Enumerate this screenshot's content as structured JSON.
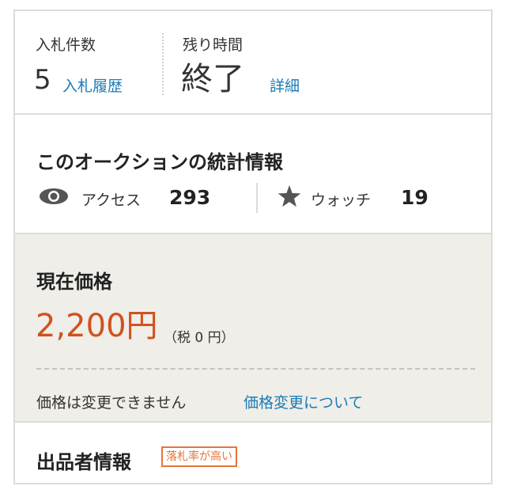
{
  "bids": {
    "count_label": "入札件数",
    "count_value": "5",
    "history_link": "入札履歴",
    "time_label": "残り時間",
    "time_value": "終了",
    "detail_link": "詳細"
  },
  "stats": {
    "title": "このオークションの統計情報",
    "access_label": "アクセス",
    "access_value": "293",
    "watch_label": "ウォッチ",
    "watch_value": "19",
    "icons": {
      "access": "eye-icon",
      "watch": "star-icon"
    }
  },
  "price": {
    "title": "現在価格",
    "value": "2,200円",
    "tax": "（税 0 円）",
    "note": "価格は変更できません",
    "about_link": "価格変更について"
  },
  "seller": {
    "title": "出品者情報",
    "badge": "落札率が高い"
  },
  "colors": {
    "link": "#1a7bb6",
    "price": "#d0521e",
    "badge": "#e8743a",
    "price_bg": "#efeee8",
    "border": "#dcdcdc"
  }
}
